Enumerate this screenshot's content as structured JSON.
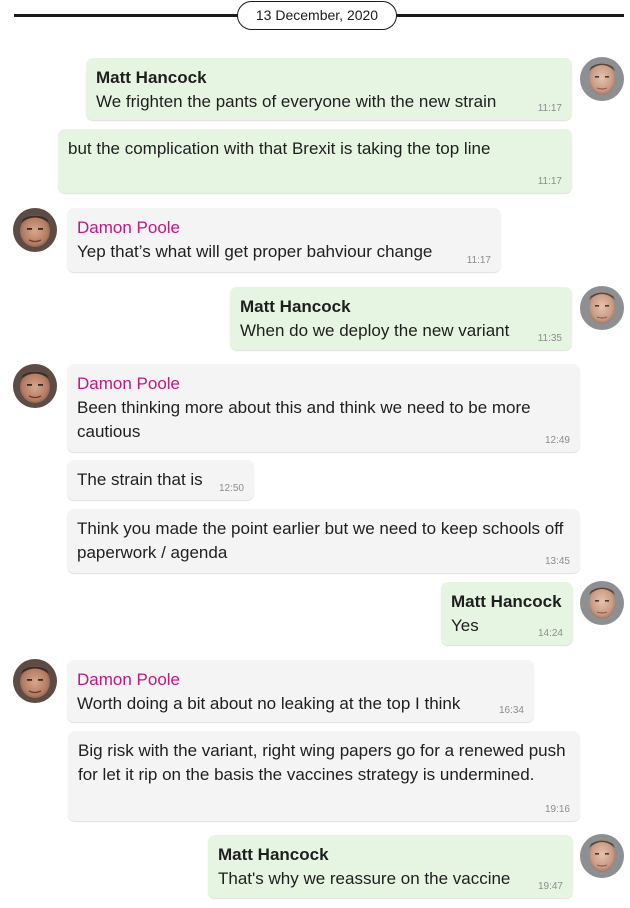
{
  "date_label": "13 December, 2020",
  "messages": [
    {
      "sender": "Matt Hancock",
      "text": "We frighten the pants of everyone with the new strain",
      "time": "11:17"
    },
    {
      "sender": "",
      "text": "but the complication with that Brexit is taking the top line",
      "time": "11:17"
    },
    {
      "sender": "Damon Poole",
      "text": "Yep that’s what will get proper bahviour change",
      "time": "11:17"
    },
    {
      "sender": "Matt Hancock",
      "text": "When do we deploy the new variant",
      "time": "11:35"
    },
    {
      "sender": "Damon Poole",
      "text": "Been thinking more about this and think we need to be more cautious",
      "time": "12:49"
    },
    {
      "sender": "",
      "text": "The strain that is",
      "time": "12:50"
    },
    {
      "sender": "",
      "text": "Think you made the point earlier but we need to keep schools off paperwork / agenda",
      "time": "13:45"
    },
    {
      "sender": "Matt Hancock",
      "text": "Yes",
      "time": "14:24"
    },
    {
      "sender": "Damon Poole",
      "text": "Worth doing a bit about no leaking at the top I think",
      "time": "16:34"
    },
    {
      "sender": "",
      "text": "Big risk with the variant, right wing papers go for a renewed push for let it rip on the basis the vaccines strategy is undermined.",
      "time": "19:16"
    },
    {
      "sender": "Matt Hancock",
      "text": "That's why we reassure on the vaccine",
      "time": "19:47"
    }
  ],
  "colors": {
    "outgoing_bubble": "#e6f5e2",
    "incoming_bubble": "#f4f4f4",
    "incoming_sender": "#c2177e",
    "timestamp": "#8c8c8c"
  },
  "icons": {
    "matt_avatar": "profile-photo-matt-hancock",
    "damon_avatar": "profile-photo-damon-poole"
  }
}
